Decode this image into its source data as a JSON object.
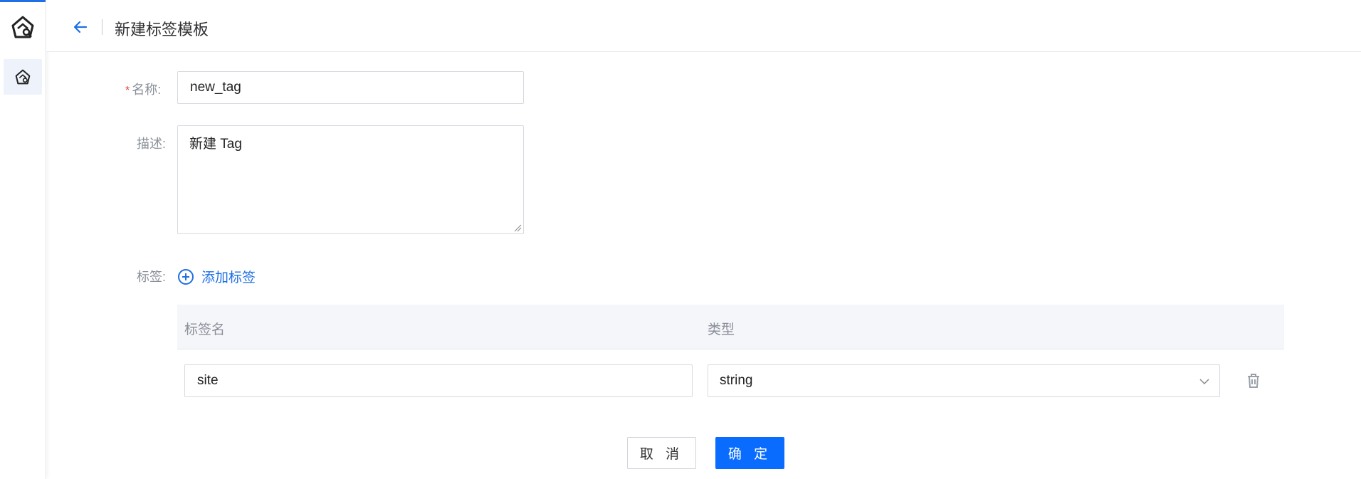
{
  "header": {
    "title": "新建标签模板"
  },
  "form": {
    "name_label": "名称:",
    "name_required_mark": "*",
    "name_value": "new_tag",
    "desc_label": "描述:",
    "desc_value": "新建 Tag",
    "tags_label": "标签:",
    "add_tag_label": "添加标签"
  },
  "table": {
    "columns": [
      "标签名",
      "类型"
    ],
    "rows": [
      {
        "tag_name": "site",
        "type": "string"
      }
    ]
  },
  "actions": {
    "cancel_label": "取 消",
    "confirm_label": "确 定"
  },
  "icons": {
    "logo": "house-logo-icon",
    "nav": "house-logo-icon",
    "back": "arrow-left-icon",
    "add": "plus-circle-icon",
    "chevron": "chevron-down-icon",
    "delete": "trash-icon"
  },
  "colors": {
    "accent": "#1f6fe5",
    "primary_button": "#0a6cff",
    "required": "#e0453a"
  }
}
